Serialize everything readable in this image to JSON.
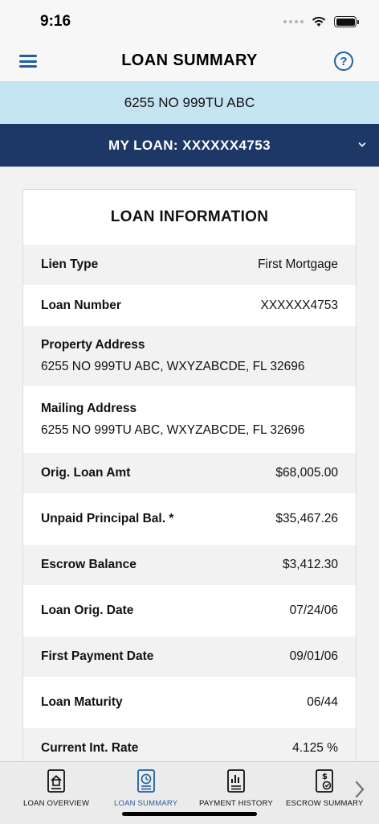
{
  "status_bar": {
    "time": "9:16"
  },
  "header": {
    "title": "LOAN SUMMARY"
  },
  "property_banner": {
    "address": "6255 NO 999TU ABC"
  },
  "loan_selector": {
    "label": "MY LOAN: XXXXXX4753"
  },
  "loan_information": {
    "title": "LOAN INFORMATION",
    "rows": [
      {
        "label": "Lien Type",
        "value": "First Mortgage"
      },
      {
        "label": "Loan Number",
        "value": "XXXXXX4753"
      },
      {
        "label": "Property Address",
        "value": "6255 NO 999TU ABC, WXYZABCDE, FL 32696"
      },
      {
        "label": "Mailing Address",
        "value": "6255 NO 999TU ABC, WXYZABCDE, FL 32696"
      },
      {
        "label": "Orig. Loan Amt",
        "value": "$68,005.00"
      },
      {
        "label": "Unpaid Principal Bal. *",
        "value": "$35,467.26"
      },
      {
        "label": "Escrow Balance",
        "value": "$3,412.30"
      },
      {
        "label": "Loan Orig. Date",
        "value": "07/24/06"
      },
      {
        "label": "First Payment Date",
        "value": "09/01/06"
      },
      {
        "label": "Loan Maturity",
        "value": "06/44"
      },
      {
        "label": "Current Int. Rate",
        "value": "4.125 %"
      }
    ]
  },
  "tab_bar": {
    "tabs": [
      {
        "label": "LOAN OVERVIEW",
        "icon": "house-document-icon"
      },
      {
        "label": "LOAN SUMMARY",
        "icon": "document-clock-icon",
        "active": true
      },
      {
        "label": "PAYMENT HISTORY",
        "icon": "document-chart-icon"
      },
      {
        "label": "ESCROW SUMMARY",
        "icon": "document-dollar-icon"
      }
    ]
  },
  "colors": {
    "accent": "#1f5fa0",
    "banner": "#c5e4f1",
    "selector": "#1d3766"
  }
}
